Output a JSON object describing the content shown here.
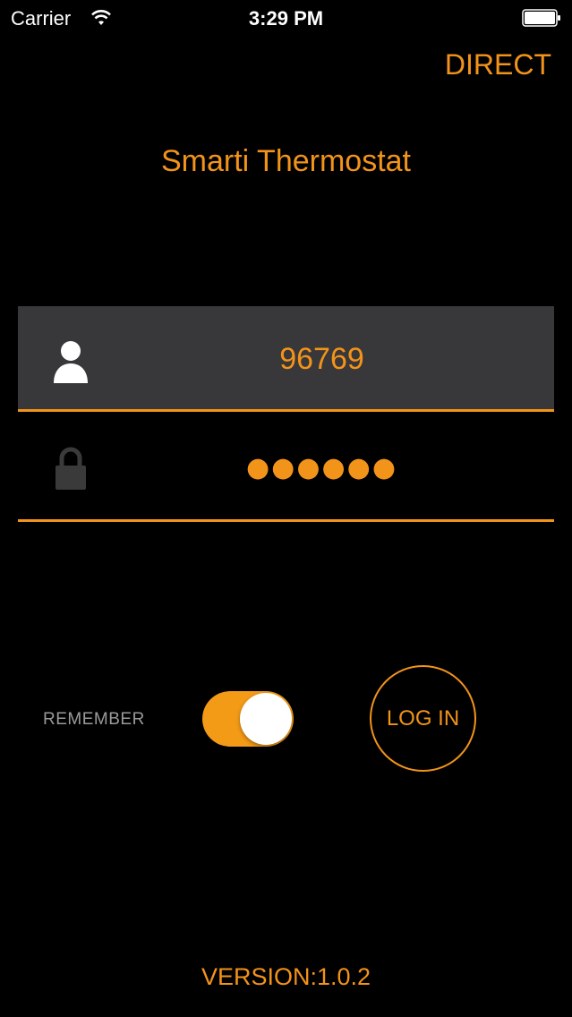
{
  "status_bar": {
    "carrier": "Carrier",
    "time": "3:29 PM"
  },
  "header": {
    "direct_label": "DIRECT",
    "title": "Smarti Thermostat"
  },
  "login_form": {
    "username_value": "96769",
    "password_masked": "●●●●●●"
  },
  "controls": {
    "remember_label": "REMEMBER",
    "remember_on": true,
    "login_label": "LOG IN"
  },
  "footer": {
    "version": "VERSION:1.0.2"
  },
  "colors": {
    "accent": "#f2931a",
    "background": "#000000",
    "field_background": "#38373a"
  },
  "icons": [
    "wifi-icon",
    "battery-icon",
    "user-icon",
    "lock-icon"
  ]
}
